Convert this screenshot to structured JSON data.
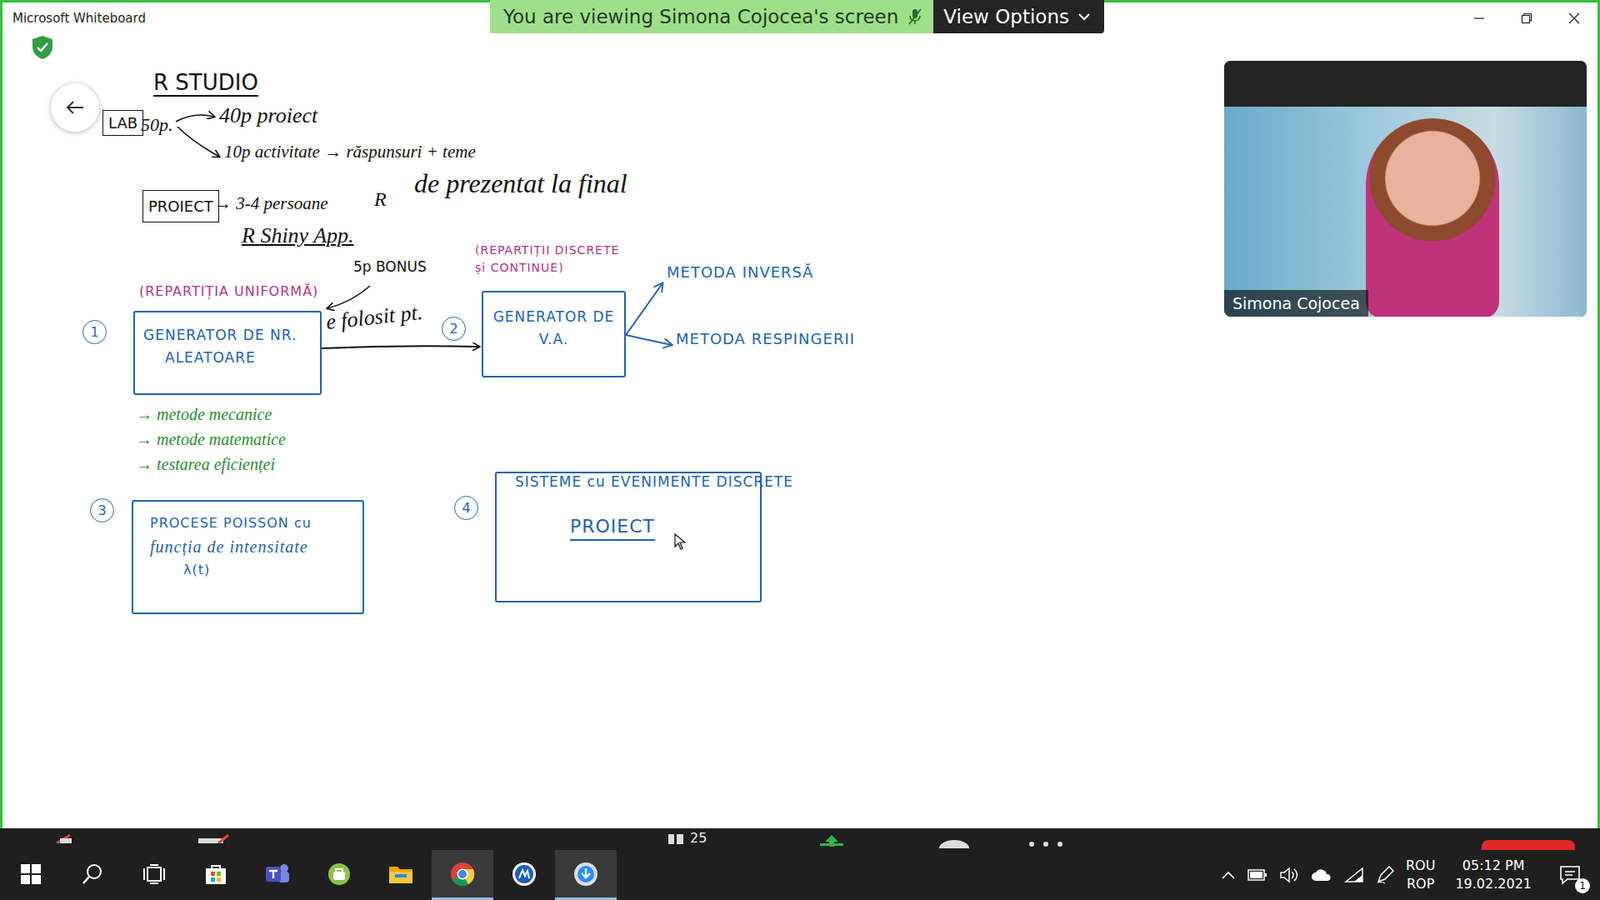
{
  "window": {
    "title": "Microsoft Whiteboard"
  },
  "share_banner": {
    "text": "You are viewing Simona Cojocea's screen",
    "button": "View Options"
  },
  "whiteboard": {
    "heading": "R STUDIO",
    "grading": {
      "label": "LAB",
      "total": "50p.",
      "parts": [
        "40p proiect",
        "10p activitate → răspunsuri + teme"
      ]
    },
    "project": {
      "label": "PROIECT",
      "team": "→ 3-4 persoane",
      "language": "R",
      "note": "de prezentat la final",
      "app": "R Shiny App."
    },
    "uniform_note": "(REPARTIȚIA UNIFORMĂ)",
    "bonus": "5p BONUS",
    "link_label": "e folosit pt.",
    "distributions_note": [
      "(REPARTIȚII DISCRETE",
      "și CONTINUE)"
    ],
    "methods": [
      "METODA INVERSĂ",
      "METODA RESPINGERII"
    ],
    "generator_notes": [
      "→ metode mecanice",
      "→ metode matematice",
      "→ testarea eficienței"
    ],
    "system_title": "SISTEME cu EVENIMENTE DISCRETE",
    "boxes": [
      {
        "number": "1",
        "lines": [
          "GENERATOR DE NR.",
          "ALEATOARE"
        ]
      },
      {
        "number": "2",
        "lines": [
          "GENERATOR DE",
          "V.A."
        ]
      },
      {
        "number": "3",
        "lines": [
          "PROCESE POISSON cu",
          "funcția de intensitate",
          "λ(t)"
        ]
      },
      {
        "number": "4",
        "lines": [
          "PROIECT"
        ]
      }
    ]
  },
  "video": {
    "name": "Simona Cojocea"
  },
  "meeting_toolbar": {
    "participants": "25"
  },
  "taskbar": {
    "apps": [
      {
        "kind": "start",
        "active": false
      },
      {
        "kind": "search",
        "active": false
      },
      {
        "kind": "taskview",
        "active": false
      },
      {
        "kind": "store",
        "active": false
      },
      {
        "kind": "teams",
        "active": false
      },
      {
        "kind": "greenapp",
        "active": false
      },
      {
        "kind": "explorer",
        "active": false
      },
      {
        "kind": "chrome",
        "active": true
      },
      {
        "kind": "whiteboard",
        "active": false
      },
      {
        "kind": "zoom",
        "active": true
      }
    ]
  },
  "tray": {
    "language": [
      "ROU",
      "ROP"
    ],
    "time": "05:12 PM",
    "date": "19.02.2021",
    "notifications": "1"
  }
}
